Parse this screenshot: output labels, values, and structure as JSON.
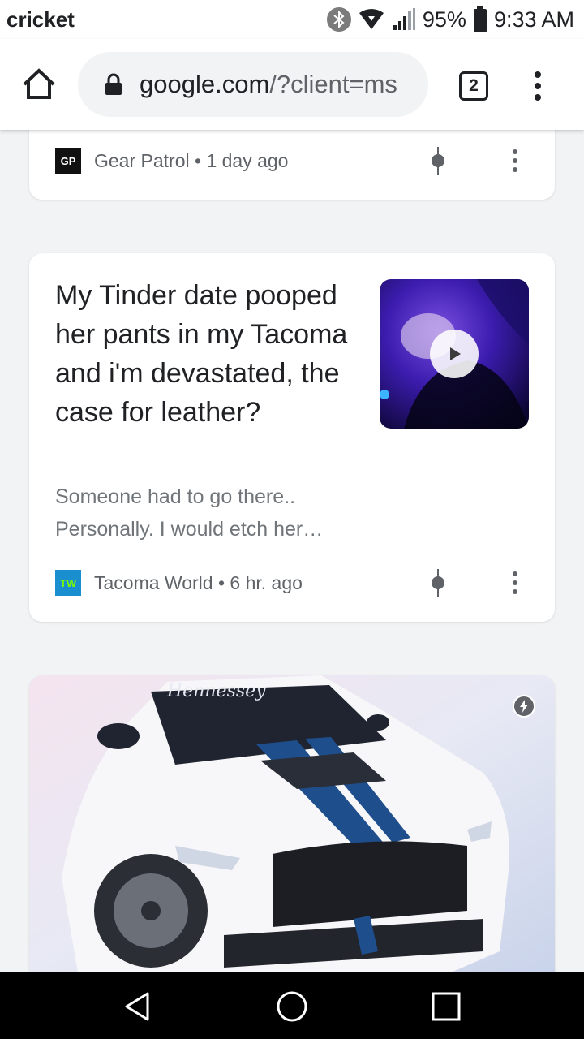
{
  "status_bar": {
    "carrier": "cricket",
    "battery": "95%",
    "time": "9:33 AM",
    "icons": [
      "bluetooth-icon",
      "wifi-icon",
      "signal-icon",
      "battery-icon"
    ]
  },
  "toolbar": {
    "url_host": "google.com",
    "url_path": "/?client=ms",
    "tab_count": "2",
    "icons": [
      "home-icon",
      "lock-icon",
      "tab-switcher-icon",
      "overflow-menu-icon"
    ]
  },
  "feed": {
    "cards": [
      {
        "source_logo_text": "GP",
        "source_meta": "Gear Patrol • 1 day ago",
        "logo_color": "#111111"
      },
      {
        "headline": "My Tinder date pooped her pants in my Tacoma and i'm devastated, the case for leather?",
        "snippet": "Someone had to go there.. Personally. I would etch her…",
        "source_logo_text": "TW",
        "source_meta": "Tacoma World • 6 hr. ago",
        "thumbnail_has_video": true,
        "logo_color": "#1a8fd0"
      },
      {
        "image_description_icon": "amp-lightning-icon",
        "image_banner_text": "Hennessey"
      }
    ]
  },
  "nav_bar": {
    "icons": [
      "back-icon",
      "home-circle-icon",
      "recents-icon"
    ]
  },
  "colors": {
    "accent_dark": "#202124",
    "meta_gray": "#5f6368",
    "background": "#f1f3f4"
  }
}
